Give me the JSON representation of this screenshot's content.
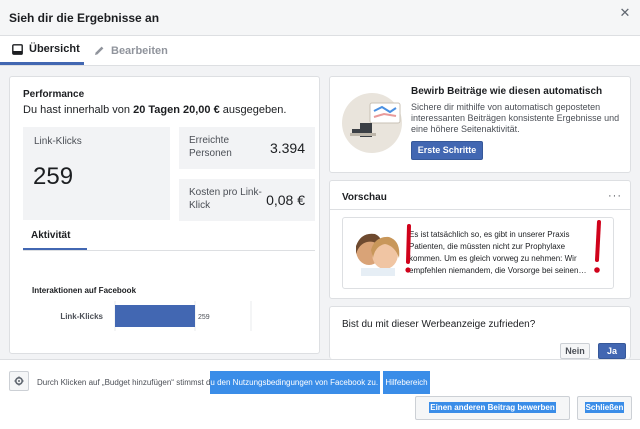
{
  "header": {
    "title": "Sieh dir die Ergebnisse an",
    "close_glyph": "✕"
  },
  "tabs": [
    {
      "label": "Übersicht",
      "icon": "overview-icon",
      "active": true
    },
    {
      "label": "Bearbeiten",
      "icon": "pencil-icon",
      "active": false
    }
  ],
  "performance": {
    "title": "Performance",
    "summary_prefix": "Du hast innerhalb von ",
    "summary_period": "20 Tagen",
    "summary_amount": "20,00 €",
    "summary_suffix": " ausgegeben.",
    "metrics": {
      "link_clicks_label": "Link-Klicks",
      "link_clicks_value": "259",
      "reach_label": "Erreichte Personen",
      "reach_value": "3.394",
      "cpc_label": "Kosten pro Link-Klick",
      "cpc_value": "0,08 €"
    },
    "activity_tab": "Aktivität",
    "chart_title": "Interaktionen auf Facebook"
  },
  "chart_data": {
    "type": "bar",
    "orientation": "horizontal",
    "categories": [
      "Link-Klicks"
    ],
    "values": [
      259
    ],
    "value_labels": [
      "259"
    ],
    "title": "Interaktionen auf Facebook",
    "xlabel": "",
    "ylabel": "",
    "grid": true,
    "bar_color": "#4267b2"
  },
  "promo": {
    "title": "Bewirb Beiträge wie diesen automatisch",
    "text": "Sichere dir mithilfe von automatisch geposteten interessanten Beiträgen konsistente Ergebnisse und eine höhere Seitenaktivität.",
    "button": "Erste Schritte"
  },
  "preview": {
    "title": "Vorschau",
    "more": "···",
    "ad_text": "Es ist tatsächlich so, es gibt in unserer Praxis Patienten, die müssten nicht zur Prophylaxe kommen. Um es gleich vorweg zu nehmen: Wir empfehlen niemandem, die Vorsorge bei seinen…"
  },
  "feedback": {
    "question": "Bist du mit dieser Werbeanzeige zufrieden?",
    "no": "Nein",
    "yes": "Ja"
  },
  "footer": {
    "terms_prefix": "Durch Klicken auf „Budget hinzufügen“ stimmst d",
    "terms_link": "u den Nutzungsbedingungen von Facebook zu. ",
    "terms_link2": "Hilfebereich",
    "other_post_button": "Einen anderen Beitrag bewerben",
    "close_button": "Schließen"
  },
  "colors": {
    "accent": "#4267b2",
    "highlight": "#3a8de8",
    "annotation_red": "#d0021b"
  }
}
